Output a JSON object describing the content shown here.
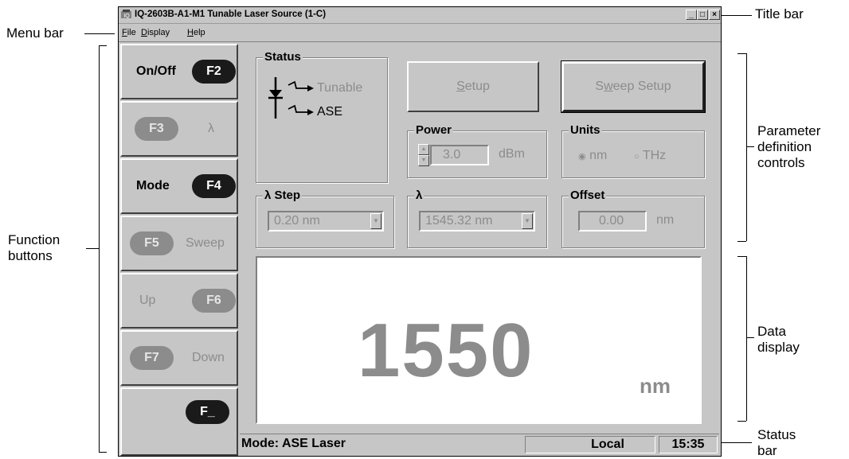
{
  "annotations": {
    "title_bar": "Title bar",
    "menu_bar": "Menu bar",
    "function_buttons": [
      "Function",
      "buttons"
    ],
    "parameter_controls": [
      "Parameter",
      "definition",
      "controls"
    ],
    "data_display": [
      "Data",
      "display"
    ],
    "status_bar": [
      "Status",
      "bar"
    ]
  },
  "window": {
    "title": "IQ-2603B-A1-M1 Tunable Laser Source  (1-C)",
    "controls": [
      "_",
      "□",
      "×"
    ]
  },
  "menu": [
    {
      "label": "File",
      "accel": "F",
      "rest": "ile"
    },
    {
      "label": "Display",
      "accel": "D",
      "rest": "isplay"
    },
    {
      "label": "Help",
      "accel": "H",
      "rest": "elp"
    }
  ],
  "function_buttons": [
    {
      "label": "On/Off",
      "key": "F2",
      "enabled": true
    },
    {
      "label": "λ",
      "key": "F3",
      "enabled": false
    },
    {
      "label": "Mode",
      "key": "F4",
      "enabled": true
    },
    {
      "label": "Sweep",
      "key": "F5",
      "enabled": false
    },
    {
      "label": "Up",
      "key": "F6",
      "enabled": false
    },
    {
      "label": "Down",
      "key": "F7",
      "enabled": false
    },
    {
      "label": "",
      "key": "F_",
      "enabled": true
    }
  ],
  "status": {
    "label": "Status",
    "tunable": "Tunable",
    "ase": "ASE"
  },
  "setup": {
    "label": "Setup",
    "accel": "S",
    "rest": "etup"
  },
  "sweep_setup": {
    "label": "Sweep Setup",
    "pre": "S",
    "accel": "w",
    "rest": "eep Setup"
  },
  "power": {
    "label": "Power",
    "value": "3.0",
    "unit": "dBm"
  },
  "units": {
    "label": "Units",
    "options": [
      "nm",
      "THz"
    ],
    "selected": "nm"
  },
  "lambda_step": {
    "label": "λ  Step",
    "value": "0.20 nm"
  },
  "lambda": {
    "label": "λ",
    "value": "1545.32 nm"
  },
  "offset": {
    "label": "Offset",
    "value": "0.00",
    "unit": "nm"
  },
  "display": {
    "value": "1550",
    "unit": "nm"
  },
  "statusbar": {
    "mode": "Mode: ASE Laser",
    "location": "Local",
    "time": "15:35"
  },
  "colors": {
    "window_bg": "#c6c6c6",
    "disabled_text": "#8c8c8c",
    "pill_dark": "#1a1a1a",
    "display_bg": "#ffffff"
  }
}
